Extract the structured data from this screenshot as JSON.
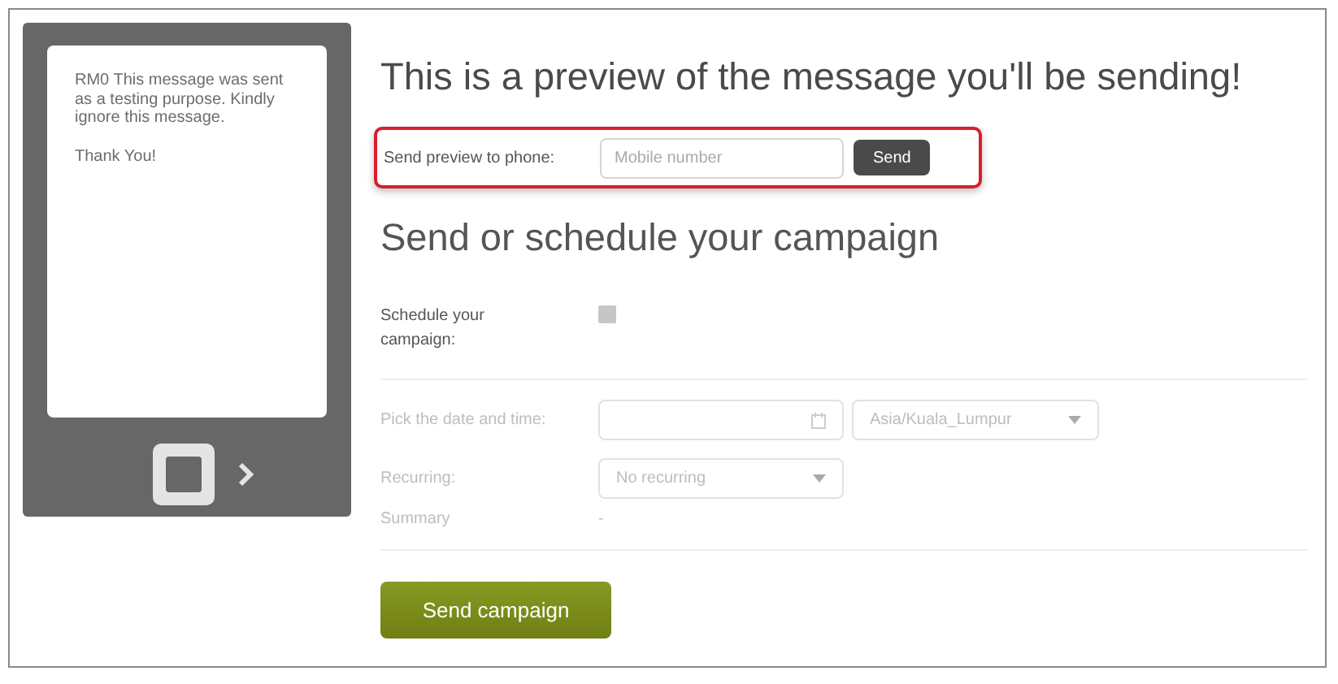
{
  "phone_preview": {
    "message": [
      "RM0 This message was sent as a testing purpose. Kindly ignore this message.",
      "Thank You!"
    ]
  },
  "preview_title": "This is a preview of the message you'll be sending!",
  "send_preview": {
    "label": "Send preview to phone:",
    "placeholder": "Mobile number",
    "button": "Send",
    "highlighted": true
  },
  "schedule_title": "Send or schedule your campaign",
  "schedule": {
    "label": "Schedule your campaign:",
    "checked": false
  },
  "rows": [
    {
      "kind": "datetime",
      "label": "Pick the date and time:",
      "disabled": true,
      "timezone": "Asia/Kuala_Lumpur"
    },
    {
      "kind": "select",
      "label": "Recurring:",
      "disabled": true,
      "value": "No recurring"
    },
    {
      "kind": "text",
      "label": "Summary",
      "disabled": true,
      "value": "-"
    }
  ],
  "submit": "Send campaign"
}
